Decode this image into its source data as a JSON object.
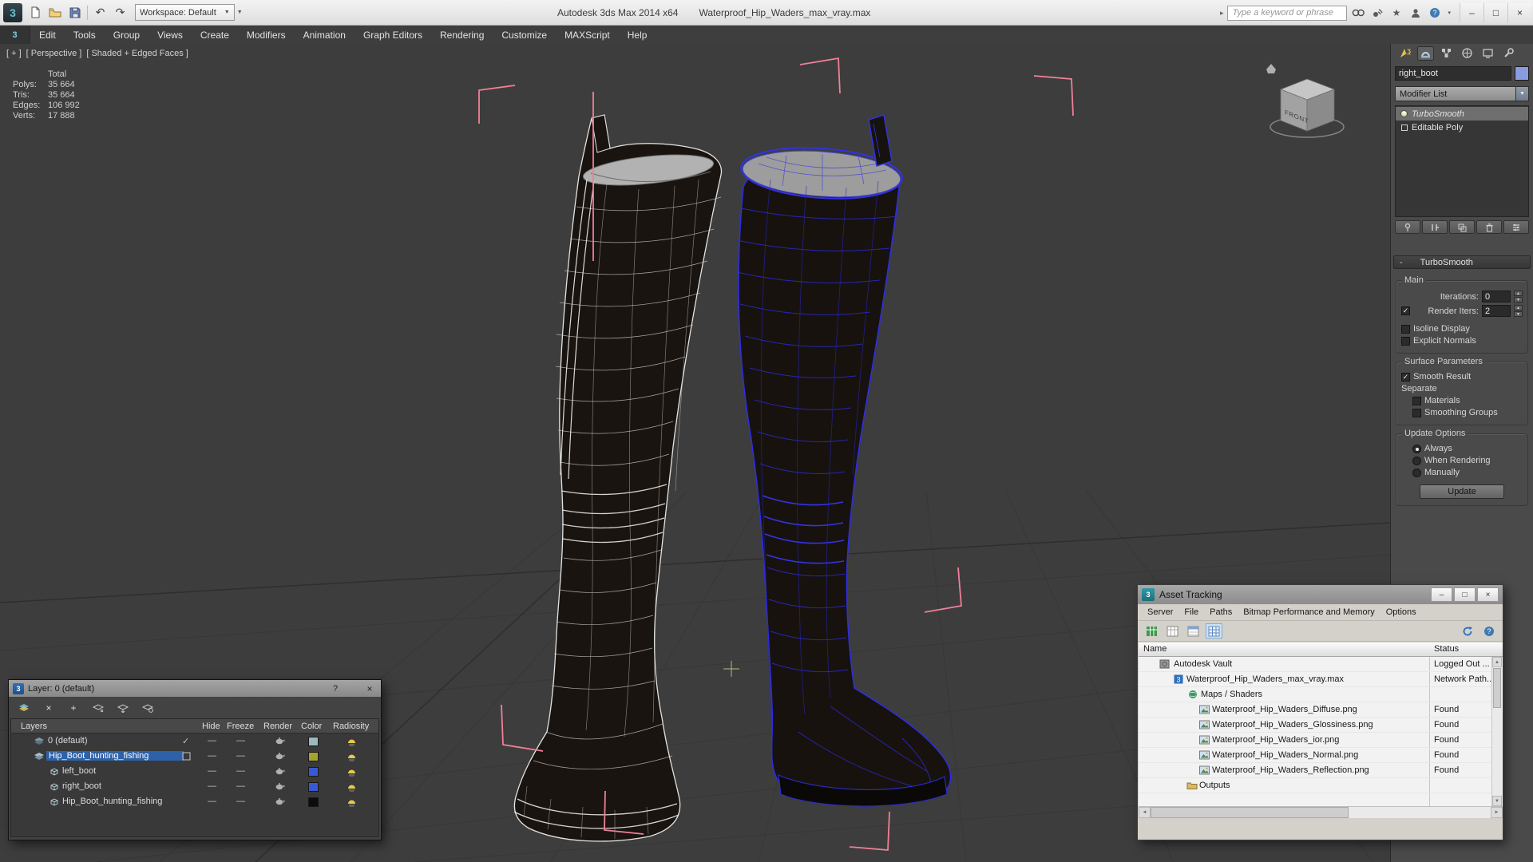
{
  "icons": {
    "app_badge": "3",
    "minimize": "–",
    "maximize": "□",
    "close": "×",
    "help": "?",
    "dropdown": "▼",
    "dropdown_small": "▾",
    "expand_right": "▸",
    "undo": "↶",
    "redo": "↷",
    "star": "★",
    "check": "✓",
    "dash": "—",
    "plus": "+",
    "delete_x": "×",
    "minus": "-",
    "spin_up": "▲",
    "spin_down": "▼",
    "scroll_up": "▲",
    "scroll_down": "▼",
    "scroll_left": "◄",
    "scroll_right": "►"
  },
  "titlebar": {
    "workspace": "Workspace: Default",
    "app_title": "Autodesk 3ds Max 2014 x64",
    "doc_title": "Waterproof_Hip_Waders_max_vray.max",
    "search_placeholder": "Type a keyword or phrase"
  },
  "menubar": {
    "items": [
      "Edit",
      "Tools",
      "Group",
      "Views",
      "Create",
      "Modifiers",
      "Animation",
      "Graph Editors",
      "Rendering",
      "Customize",
      "MAXScript",
      "Help"
    ]
  },
  "viewport": {
    "label_segments": [
      "[ + ]",
      "[ Perspective ]",
      "[ Shaded + Edged Faces ]"
    ],
    "stats": {
      "title": "Total",
      "rows": [
        {
          "label": "Polys:",
          "value": "35 664"
        },
        {
          "label": "Tris:",
          "value": "35 664"
        },
        {
          "label": "Edges:",
          "value": "106 992"
        },
        {
          "label": "Verts:",
          "value": "17 888"
        }
      ]
    },
    "viewcube_front": "FRONT"
  },
  "command_panel": {
    "object_name": "right_boot",
    "object_color": "#8a9ce0",
    "modifier_list": "Modifier List",
    "stack": [
      {
        "label": "TurboSmooth"
      },
      {
        "label": "Editable Poly"
      }
    ],
    "turbosmooth": {
      "title": "TurboSmooth",
      "main_group": "Main",
      "iterations_label": "Iterations:",
      "iterations_value": "0",
      "render_iters_label": "Render Iters:",
      "render_iters_value": "2",
      "isoline_display": "Isoline Display",
      "explicit_normals": "Explicit Normals",
      "surface_group": "Surface Parameters",
      "smooth_result": "Smooth Result",
      "separate_label": "Separate",
      "materials": "Materials",
      "smoothing_groups": "Smoothing Groups",
      "update_group": "Update Options",
      "always": "Always",
      "when_rendering": "When Rendering",
      "manually": "Manually",
      "update_button": "Update"
    }
  },
  "layer_dialog": {
    "title": "Layer: 0 (default)",
    "columns": [
      "Layers",
      "Hide",
      "Freeze",
      "Render",
      "Color",
      "Radiosity"
    ],
    "rows": [
      {
        "name": "0 (default)",
        "color": "#9fb8c0"
      },
      {
        "name": "Hip_Boot_hunting_fishing",
        "color": "#a3a32e"
      },
      {
        "name": "left_boot",
        "color": "#3a57d4"
      },
      {
        "name": "right_boot",
        "color": "#3a57d4"
      },
      {
        "name": "Hip_Boot_hunting_fishing",
        "color": "#0c0c0c"
      }
    ]
  },
  "asset_tracking": {
    "title": "Asset Tracking",
    "menu": [
      "Server",
      "File",
      "Paths",
      "Bitmap Performance and Memory",
      "Options"
    ],
    "columns": [
      "Name",
      "Status"
    ],
    "rows": [
      {
        "name": "Autodesk Vault",
        "status": "Logged Out ..."
      },
      {
        "name": "Waterproof_Hip_Waders_max_vray.max",
        "status": "Network Path..."
      },
      {
        "name": "Maps / Shaders",
        "status": ""
      },
      {
        "name": "Waterproof_Hip_Waders_Diffuse.png",
        "status": "Found"
      },
      {
        "name": "Waterproof_Hip_Waders_Glossiness.png",
        "status": "Found"
      },
      {
        "name": "Waterproof_Hip_Waders_ior.png",
        "status": "Found"
      },
      {
        "name": "Waterproof_Hip_Waders_Normal.png",
        "status": "Found"
      },
      {
        "name": "Waterproof_Hip_Waders_Reflection.png",
        "status": "Found"
      },
      {
        "name": "Outputs",
        "status": ""
      }
    ]
  }
}
